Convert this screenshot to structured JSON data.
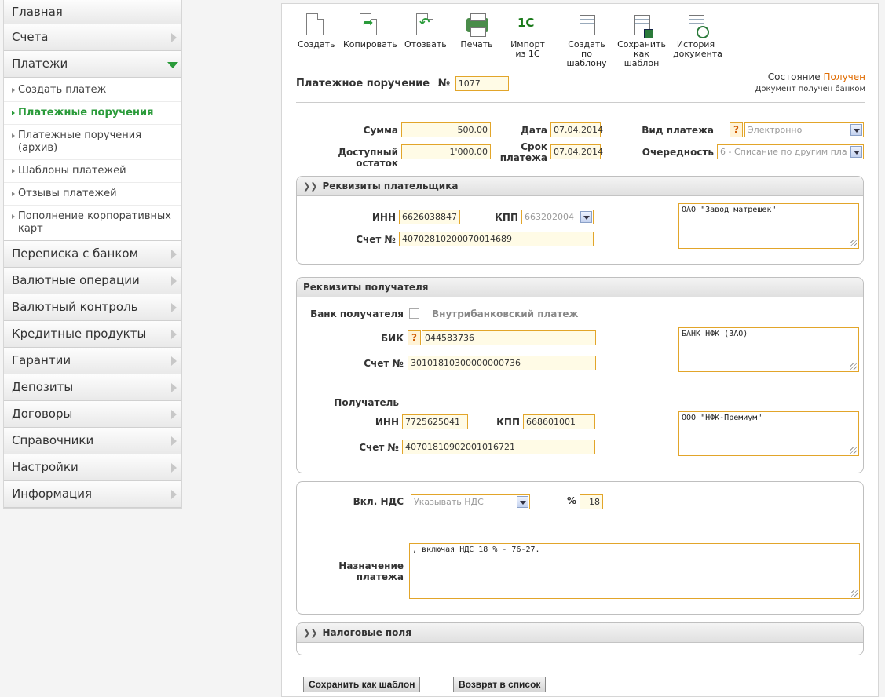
{
  "sidebar": {
    "items_top": [
      {
        "label": "Главная"
      },
      {
        "label": "Счета"
      },
      {
        "label": "Платежи"
      }
    ],
    "submenu": [
      {
        "label": "Создать платеж"
      },
      {
        "label": "Платежные поручения"
      },
      {
        "label": "Платежные поручения (архив)"
      },
      {
        "label": "Шаблоны платежей"
      },
      {
        "label": "Отзывы платежей"
      },
      {
        "label": "Пополнение корпоративных карт"
      }
    ],
    "items_bottom": [
      {
        "label": "Переписка с банком"
      },
      {
        "label": "Валютные операции"
      },
      {
        "label": "Валютный контроль"
      },
      {
        "label": "Кредитные продукты"
      },
      {
        "label": "Гарантии"
      },
      {
        "label": "Депозиты"
      },
      {
        "label": "Договоры"
      },
      {
        "label": "Справочники"
      },
      {
        "label": "Настройки"
      },
      {
        "label": "Информация"
      }
    ]
  },
  "toolbar": {
    "create": "Создать",
    "copy": "Копировать",
    "revoke": "Отозвать",
    "print": "Печать",
    "import_1": "Импорт",
    "import_2": "из 1С",
    "from_tpl_1": "Создать",
    "from_tpl_2": "по шаблону",
    "save_tpl_1": "Сохранить",
    "save_tpl_2": "как шаблон",
    "history_1": "История",
    "history_2": "документа"
  },
  "doc": {
    "title": "Платежное поручение",
    "number_label": "№",
    "number": "1077",
    "state_label": "Состояние",
    "state_value": "Получен",
    "state_sub": "Документ получен банком"
  },
  "amount": {
    "sum_label": "Сумма",
    "sum": "500.00",
    "balance_label": "Доступный остаток",
    "balance": "1'000.00",
    "date_label": "Дата",
    "date": "07.04.2014",
    "term_label_1": "Срок",
    "term_label_2": "платежа",
    "term": "07.04.2014",
    "type_label": "Вид платежа",
    "type_qmark": "?",
    "type_value": "Электронно",
    "priority_label": "Очередность",
    "priority_value": "6 - Списание по другим пла"
  },
  "payer": {
    "header": "Реквизиты плательщика",
    "inn_label": "ИНН",
    "inn": "6626038847",
    "kpp_label": "КПП",
    "kpp": "663202004",
    "account_label": "Счет №",
    "account": "40702810200070014689",
    "name": "ОАО \"Завод матрешек\""
  },
  "receiver": {
    "header": "Реквизиты получателя",
    "bank_label": "Банк получателя",
    "intrabank_label": "Внутрибанковский платеж",
    "bik_label": "БИК",
    "bik_qmark": "?",
    "bik": "044583736",
    "bank_account_label": "Счет №",
    "bank_account": "30101810300000000736",
    "bank_name": "БАНК НФК (ЗАО)",
    "payee_label": "Получатель",
    "inn_label": "ИНН",
    "inn": "7725625041",
    "kpp_label": "КПП",
    "kpp": "668601001",
    "account_label": "Счет №",
    "account": "40701810902001016721",
    "name": "ООО \"НФК-Премиум\""
  },
  "vat": {
    "label": "Вкл. НДС",
    "mode": "Указывать НДС",
    "pct_label": "%",
    "pct": "18",
    "purpose_label_1": "Назначение",
    "purpose_label_2": "платежа",
    "purpose": ", включая НДС 18 % - 76-27."
  },
  "tax": {
    "header": "Налоговые поля"
  },
  "buttons": {
    "save_template": "Сохранить как шаблон",
    "back": "Возврат в список"
  },
  "colors": {
    "accent_green": "#2a9b3a",
    "field_border": "#e2a52a",
    "state_orange": "#e06b00"
  }
}
